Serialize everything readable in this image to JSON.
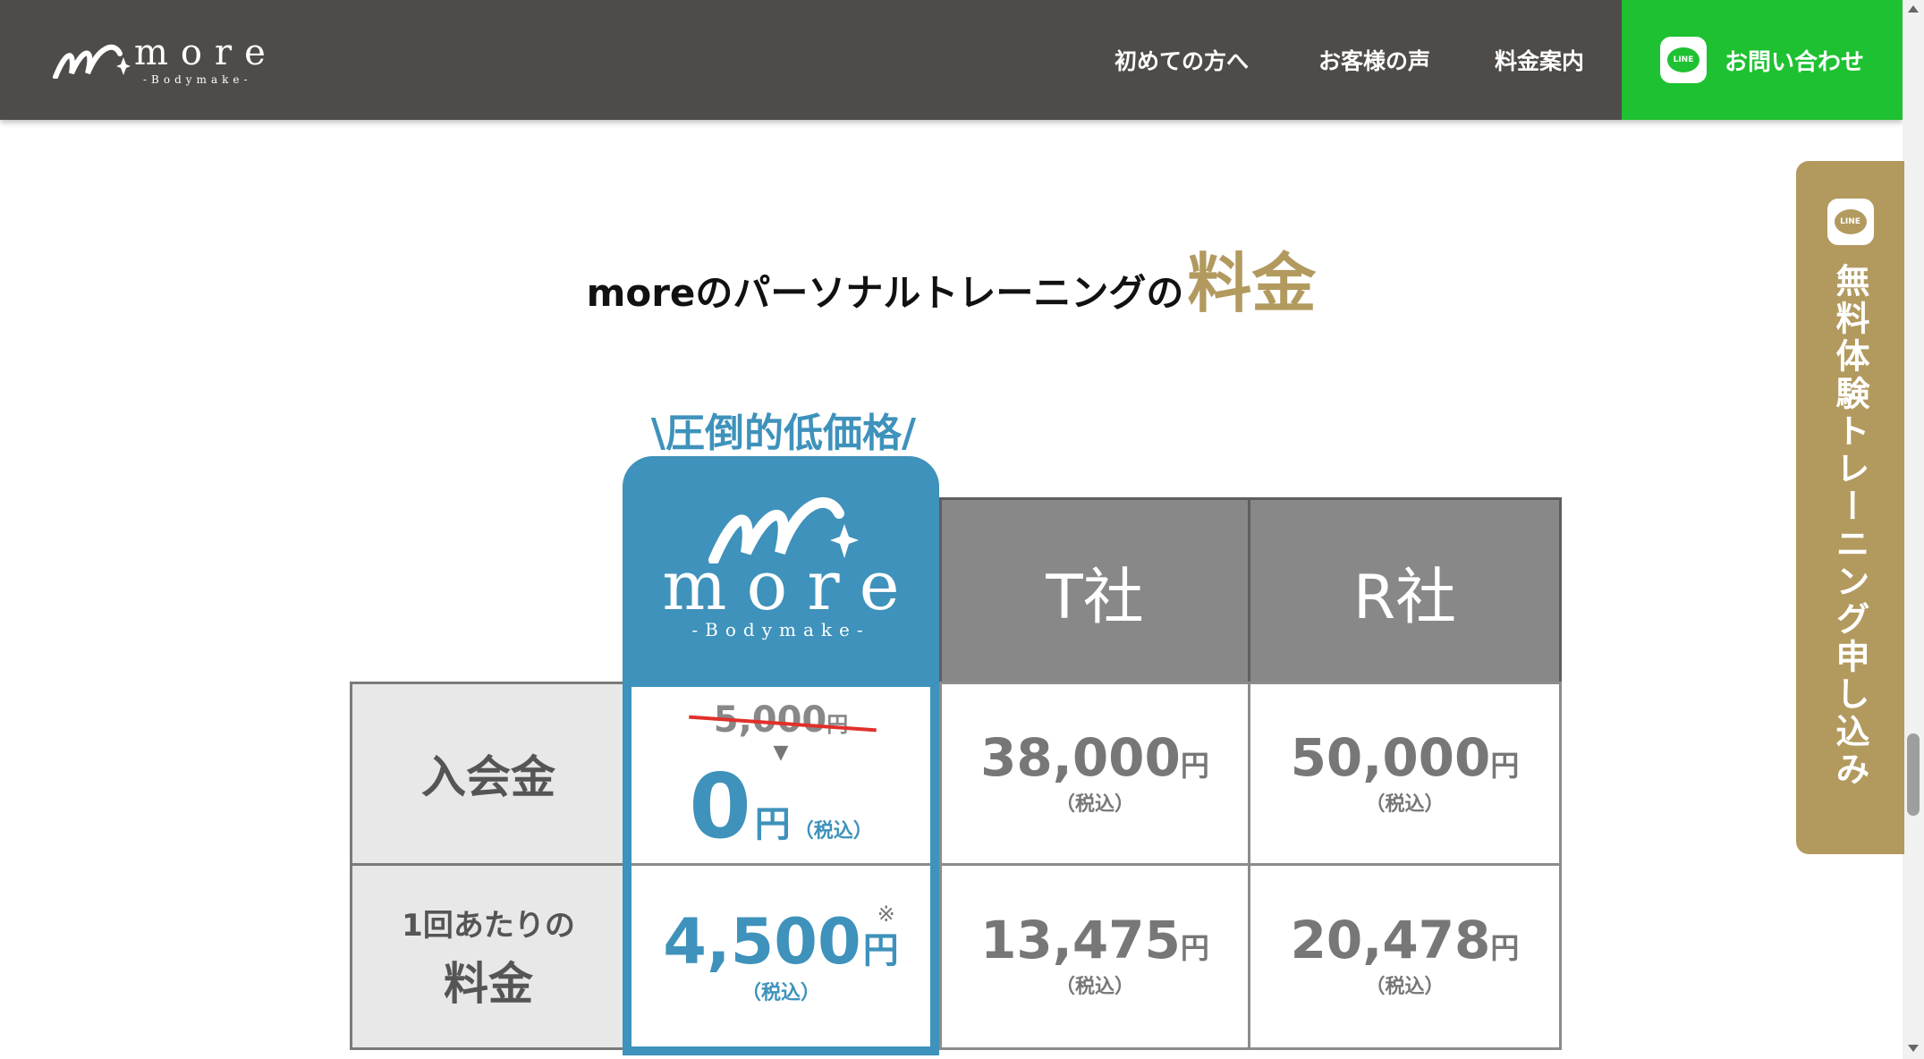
{
  "header": {
    "logo_word": "more",
    "logo_sub": "-Bodymake-",
    "nav": [
      "初めての方へ",
      "お客様の声",
      "料金案内"
    ],
    "contact_label": "お問い合わせ",
    "line_badge": "LINE"
  },
  "side_tab": {
    "line_badge": "LINE",
    "label": "無料体験トレーニング申し込み"
  },
  "section": {
    "title_main": "moreのパーソナルトレーニングの",
    "title_accent": "料金",
    "tagline": "\\圧倒的低価格/"
  },
  "pricing": {
    "columns": {
      "more_word": "more",
      "more_sub": "-Bodymake-",
      "t": "T社",
      "r": "R社"
    },
    "rows": [
      {
        "label": "入会金",
        "more": {
          "old": "5,000",
          "old_unit": "円",
          "arrow": "▼",
          "value": "0",
          "unit": "円",
          "tax": "（税込）"
        },
        "t": {
          "value": "38,000",
          "unit": "円",
          "tax": "（税込）"
        },
        "r": {
          "value": "50,000",
          "unit": "円",
          "tax": "（税込）"
        }
      },
      {
        "label_line1": "1回あたりの",
        "label_line2": "料金",
        "more": {
          "value": "4,500",
          "mark": "※",
          "unit": "円",
          "tax": "（税込）"
        },
        "t": {
          "value": "13,475",
          "unit": "円",
          "tax": "（税込）"
        },
        "r": {
          "value": "20,478",
          "unit": "円",
          "tax": "（税込）"
        }
      }
    ]
  },
  "colors": {
    "header_bg": "#4f4b49",
    "line_green": "#1ec131",
    "gold": "#b29a5f",
    "brand_blue": "#3e92bb"
  }
}
